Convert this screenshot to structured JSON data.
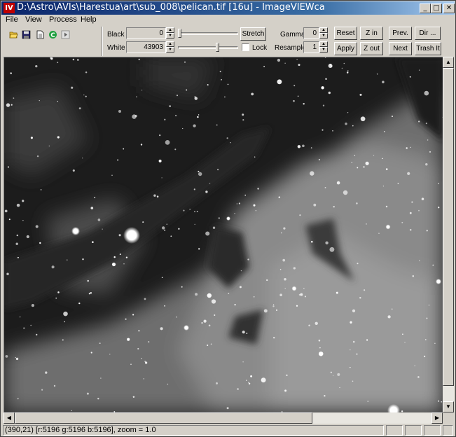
{
  "window": {
    "app_icon": "IV",
    "title": "D:\\Astro\\AVIs\\Harestua\\art\\sub_008\\pelican.tif [16u] - ImageVIEWca",
    "minimize": "_",
    "maximize": "□",
    "close": "✕"
  },
  "menu": {
    "items": [
      "File",
      "View",
      "Process",
      "Help"
    ]
  },
  "toolbar": {
    "icons": [
      "open-folder-icon",
      "save-icon",
      "document-icon",
      "refresh-icon",
      "play-icon"
    ],
    "black_label": "Black",
    "black_value": "0",
    "white_label": "White",
    "white_value": "43903",
    "stretch_label": "Stretch",
    "lock_label": "Lock",
    "lock_checked": false,
    "gamma_label": "Gamma",
    "gamma_value": "0",
    "resample_label": "Resample",
    "resample_value": "1",
    "buttons": {
      "reset": "Reset",
      "apply": "Apply",
      "zoom_in": "Z in",
      "zoom_out": "Z out",
      "prev": "Prev.",
      "next": "Next",
      "dir": "Dir ...",
      "trash": "Trash It"
    },
    "black_slider_fraction": 0.0,
    "white_slider_fraction": 0.67
  },
  "image": {
    "description_icon": "nebula-image",
    "colors": {
      "background": "#1b1b1b"
    }
  },
  "scrollbars": {
    "up": "▲",
    "down": "▼",
    "left": "◀",
    "right": "▶"
  },
  "status": {
    "text": "(390,21) [r:5196 g:5196 b:5196], zoom = 1.0"
  }
}
